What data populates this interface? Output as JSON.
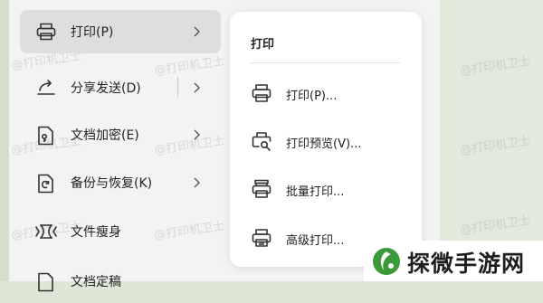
{
  "menu": {
    "items": [
      {
        "label": "打印(P)",
        "icon": "printer-icon",
        "has_submenu": true
      },
      {
        "label": "分享发送(D)",
        "icon": "share-icon",
        "has_submenu": true
      },
      {
        "label": "文档加密(E)",
        "icon": "encrypt-icon",
        "has_submenu": true
      },
      {
        "label": "备份与恢复(K)",
        "icon": "backup-icon",
        "has_submenu": true
      },
      {
        "label": "文件瘦身",
        "icon": "slim-icon",
        "has_submenu": false
      },
      {
        "label": "文档定稿",
        "icon": "finalize-icon",
        "has_submenu": false
      }
    ]
  },
  "submenu": {
    "title": "打印",
    "items": [
      {
        "label": "打印(P)...",
        "icon": "printer-icon"
      },
      {
        "label": "打印预览(V)...",
        "icon": "print-preview-icon"
      },
      {
        "label": "批量打印...",
        "icon": "batch-print-icon"
      },
      {
        "label": "高级打印...",
        "icon": "advanced-print-icon"
      }
    ]
  },
  "watermark": "@打印机卫士",
  "brand": {
    "name": "探微手游网",
    "color": "#3a9a3a"
  }
}
